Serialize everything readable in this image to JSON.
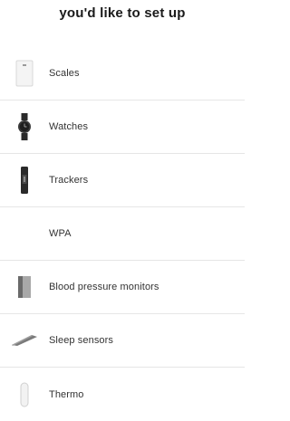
{
  "header": {
    "title": "you'd like to set up"
  },
  "devices": [
    {
      "label": "Scales",
      "icon": "scale-icon"
    },
    {
      "label": "Watches",
      "icon": "watch-icon"
    },
    {
      "label": "Trackers",
      "icon": "tracker-icon"
    },
    {
      "label": "WPA",
      "icon": ""
    },
    {
      "label": "Blood pressure monitors",
      "icon": "blood-pressure-monitor-icon"
    },
    {
      "label": "Sleep sensors",
      "icon": "sleep-sensor-icon"
    },
    {
      "label": "Thermo",
      "icon": "thermometer-icon"
    }
  ],
  "colors": {
    "divider": "#e6e6e6",
    "text": "#333333"
  }
}
